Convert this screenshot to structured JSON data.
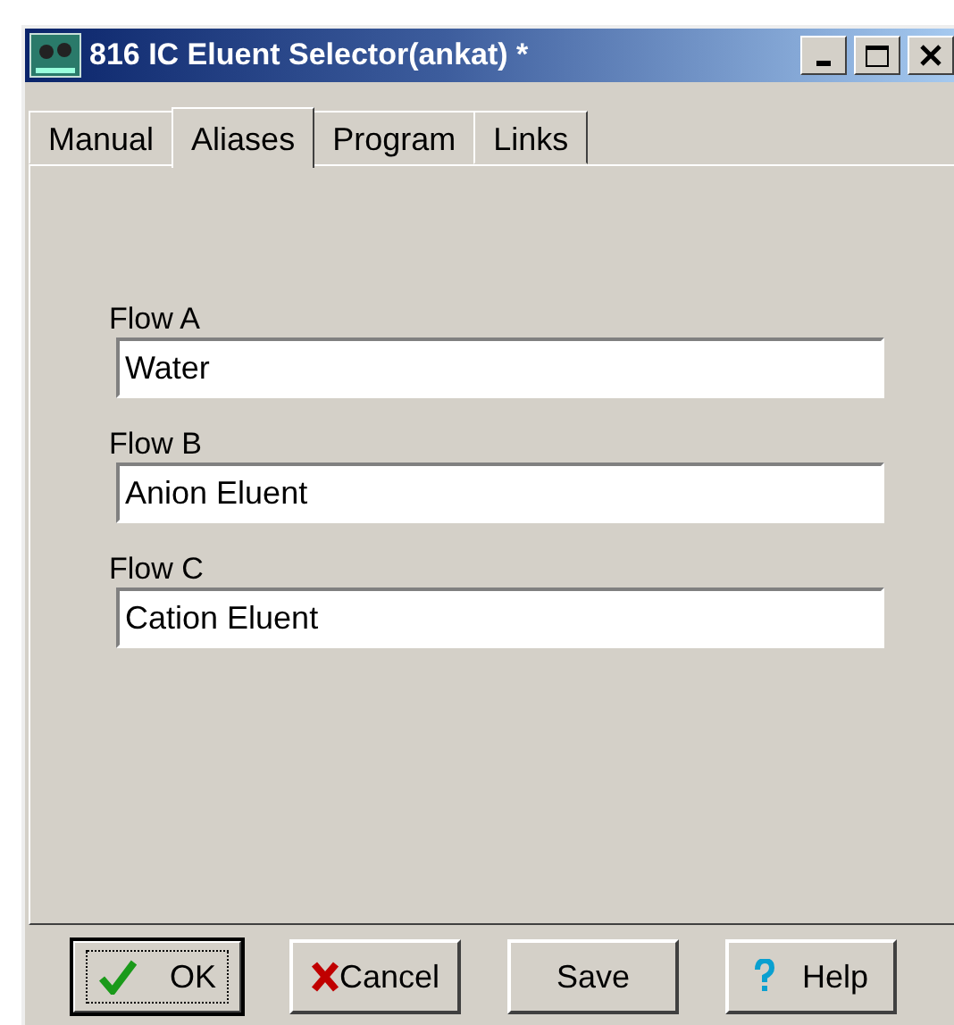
{
  "window": {
    "title": "816 IC Eluent Selector(ankat) *"
  },
  "tabs": [
    {
      "label": "Manual",
      "selected": false
    },
    {
      "label": "Aliases",
      "selected": true
    },
    {
      "label": "Program",
      "selected": false
    },
    {
      "label": "Links",
      "selected": false
    }
  ],
  "fields": [
    {
      "label": "Flow A",
      "value": "Water"
    },
    {
      "label": "Flow B",
      "value": "Anion Eluent"
    },
    {
      "label": "Flow C",
      "value": "Cation Eluent"
    }
  ],
  "buttons": [
    {
      "label": "OK",
      "kind": "ok",
      "default": true
    },
    {
      "label": "Cancel",
      "kind": "cancel",
      "default": false
    },
    {
      "label": "Save",
      "kind": "plain",
      "default": false
    },
    {
      "label": "Help",
      "kind": "help",
      "default": false
    }
  ]
}
